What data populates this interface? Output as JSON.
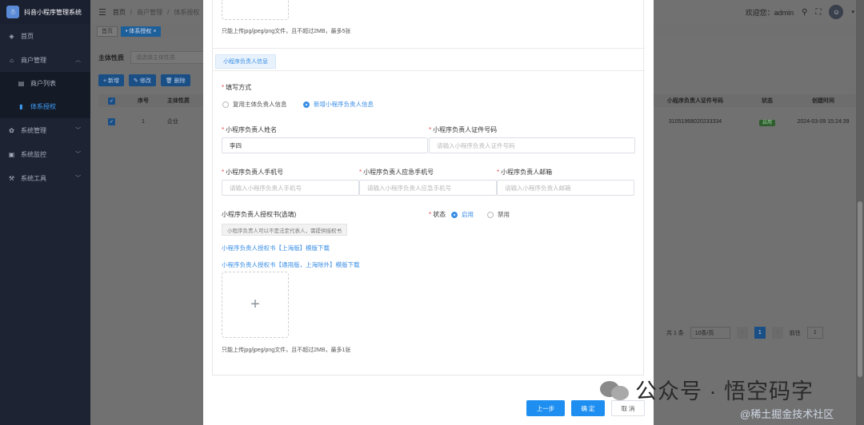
{
  "sidebar": {
    "brand": "抖音小程序管理系统",
    "items": [
      {
        "label": "首页",
        "icon": "dashboard-icon"
      },
      {
        "label": "商户管理",
        "icon": "shop-icon",
        "expanded": true
      },
      {
        "label": "商户列表",
        "icon": "list-icon",
        "sub": true
      },
      {
        "label": "体系授权",
        "icon": "auth-icon",
        "sub": true,
        "active": true
      },
      {
        "label": "系统管理",
        "icon": "gear-icon"
      },
      {
        "label": "系统监控",
        "icon": "monitor-icon"
      },
      {
        "label": "系统工具",
        "icon": "tool-icon"
      }
    ]
  },
  "header": {
    "crumbs": [
      "首页",
      "/",
      "商户管理",
      "/",
      "体系授权"
    ],
    "welcome": "欢迎您：admin"
  },
  "tags": [
    "首页",
    "• 体系授权 ×"
  ],
  "bg": {
    "filter_label": "主体性质",
    "filter_placeholder": "请选择主体性质",
    "buttons": [
      "+ 新增",
      "✎ 修改",
      "🗑 删除"
    ],
    "columns": [
      "序号",
      "主体性质",
      "小程序负责人证件号码",
      "状态",
      "创建时间"
    ],
    "row": {
      "index": "1",
      "nature": "企业",
      "id_no": "31051968020233334",
      "status": "启用",
      "created": "2024-03-09 15:24:39"
    },
    "pager": {
      "total": "共 1 条",
      "size": "10条/页",
      "page": "1",
      "goto_label": "前往",
      "goto_value": "1"
    }
  },
  "dialog": {
    "top_hint": "只能上传jpg/jpeg/png文件，且不超过2MB，最多5张",
    "section_tab": "小程序负责人信息",
    "fill_method_label": "填写方式",
    "fill_option_1": "复用主体负责人信息",
    "fill_option_2": "新增小程序负责人信息",
    "name_label": "小程序负责人姓名",
    "name_value": "李四",
    "id_label": "小程序负责人证件号码",
    "id_placeholder": "请输入小程序负责人证件号码",
    "phone_label": "小程序负责人手机号",
    "phone_placeholder": "请输入小程序负责人手机号",
    "emergency_label": "小程序负责人应急手机号",
    "emergency_placeholder": "请输入小程序负责人应急手机号",
    "email_label": "小程序负责人邮箱",
    "email_placeholder": "请输入小程序负责人邮箱",
    "auth_label": "小程序负责人授权书(选填)",
    "status_label": "状态",
    "status_on": "启用",
    "status_off": "禁用",
    "auth_note": "小程序负责人可以不是法定代表人，需提供授权书",
    "link_shanghai": "小程序负责人授权书【上海版】模版下载",
    "link_general": "小程序负责人授权书【通用版，上海除外】模版下载",
    "bottom_hint": "只能上传jpg/jpeg/png文件，且不超过2MB，最多1张",
    "btn_prev": "上一步",
    "btn_ok": "确 定",
    "btn_cancel": "取 消"
  },
  "watermark": {
    "text": "公众号 · 悟空码字",
    "site": "@稀土掘金技术社区"
  }
}
